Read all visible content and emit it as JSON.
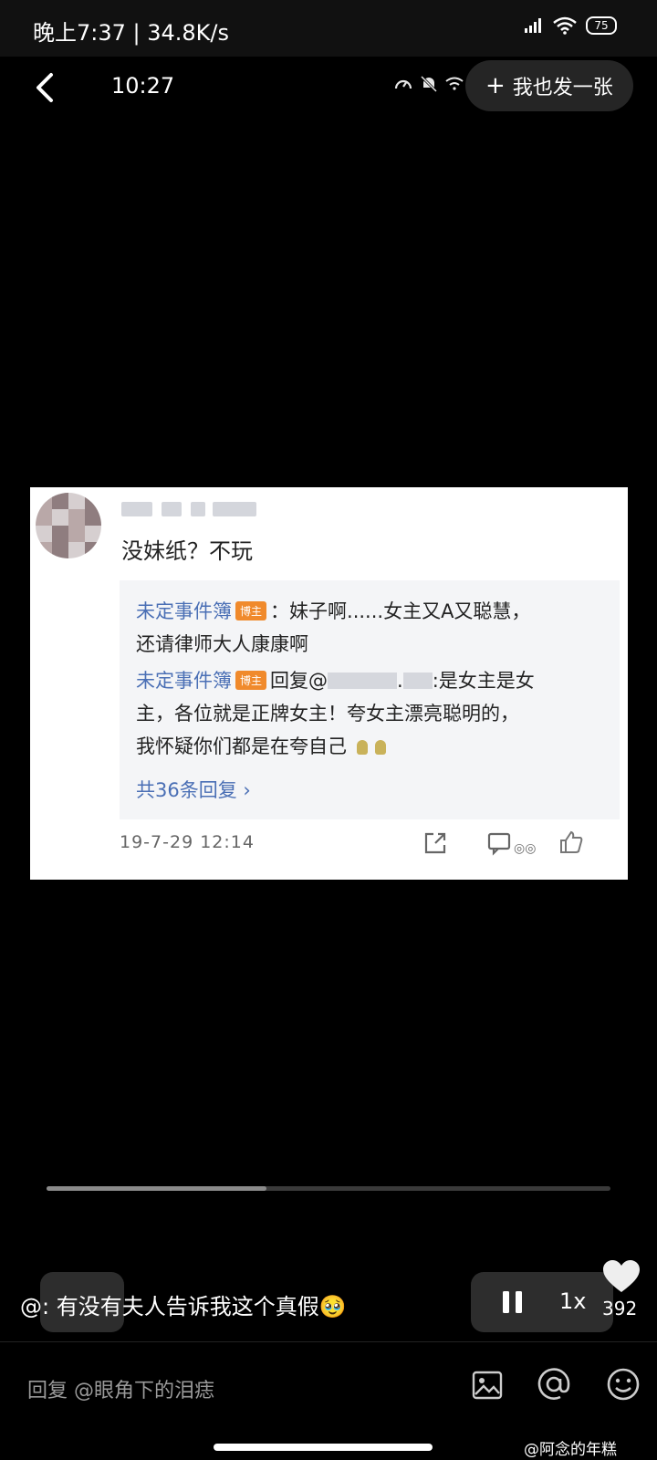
{
  "status_bar": {
    "time_speed": "晚上7:37 | 34.8K/s",
    "battery": "75"
  },
  "header": {
    "inner_time": "10:27",
    "post_button_label": "我也发一张"
  },
  "card": {
    "comment_text": "没妹纸？不玩",
    "replies": [
      {
        "name": "未定事件簿",
        "badge": "博主",
        "line1": "：妹子啊......女主又A又聪慧，",
        "line2": "还请律师大人康康啊"
      },
      {
        "name": "未定事件簿",
        "badge": "博主",
        "prefix": "回复@",
        "middle": ".",
        "suffix": ":是女主是女",
        "line2": "主，各位就是正牌女主！夸女主漂亮聪明的，",
        "line3": "我怀疑你们都是在夸自己"
      }
    ],
    "more_replies": "共36条回复 ›",
    "date": "19-7-29 12:14"
  },
  "player": {
    "progress": 0.39,
    "caption": "@: 有没有夫人告诉我这个真假🥹",
    "speed": "1x",
    "like_count": "392"
  },
  "reply_bar": {
    "placeholder": "回复 @眼角下的泪痣"
  },
  "watermark": "@阿念的年糕",
  "colors": {
    "background": "#000000",
    "link_blue": "#4a6fb5",
    "badge_orange": "#f08a2c"
  }
}
